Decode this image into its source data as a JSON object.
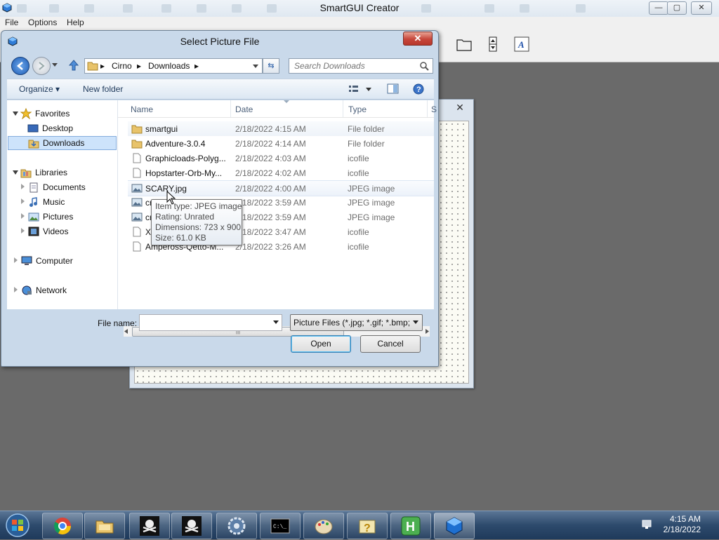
{
  "app": {
    "title": "SmartGUI Creator",
    "menu": [
      "File",
      "Options",
      "Help"
    ],
    "win_min": "—",
    "win_max": "▢",
    "win_close": "✕"
  },
  "form_window": {
    "close_label": "✕"
  },
  "dialog": {
    "title": "Select Picture File",
    "close_label": "✕",
    "breadcrumb": [
      "Cirno",
      "Downloads"
    ],
    "search_placeholder": "Search Downloads",
    "organize_label": "Organize ▾",
    "new_folder_label": "New folder",
    "nav": {
      "favorites": "Favorites",
      "desktop": "Desktop",
      "downloads": "Downloads",
      "libraries": "Libraries",
      "documents": "Documents",
      "music": "Music",
      "pictures": "Pictures",
      "videos": "Videos",
      "computer": "Computer",
      "network": "Network"
    },
    "columns": {
      "name": "Name",
      "date": "Date",
      "type": "Type",
      "size": "S"
    },
    "files": [
      {
        "name": "smartgui",
        "date": "2/18/2022 4:15 AM",
        "type": "File folder",
        "icon": "folder-icon"
      },
      {
        "name": "Adventure-3.0.4",
        "date": "2/18/2022 4:14 AM",
        "type": "File folder",
        "icon": "folder-icon"
      },
      {
        "name": "Graphicloads-Polyg...",
        "date": "2/18/2022 4:03 AM",
        "type": "icofile",
        "icon": "file-icon"
      },
      {
        "name": "Hopstarter-Orb-My...",
        "date": "2/18/2022 4:02 AM",
        "type": "icofile",
        "icon": "file-icon"
      },
      {
        "name": "SCARY.jpg",
        "date": "2/18/2022 4:00 AM",
        "type": "JPEG image",
        "icon": "image-icon"
      },
      {
        "name": "cr",
        "date": "2/18/2022 3:59 AM",
        "type": "JPEG image",
        "icon": "image-icon"
      },
      {
        "name": "cr",
        "date": "2/18/2022 3:59 AM",
        "type": "JPEG image",
        "icon": "image-icon"
      },
      {
        "name": "Xe",
        "date": "2/18/2022 3:47 AM",
        "type": "icofile",
        "icon": "file-icon"
      },
      {
        "name": "Ampeross-Qetto-M...",
        "date": "2/18/2022 3:26 AM",
        "type": "icofile",
        "icon": "file-icon"
      }
    ],
    "tooltip": {
      "item_type": "Item type: JPEG image",
      "rating": "Rating: Unrated",
      "dimensions": "Dimensions: 723 x 900",
      "size": "Size: 61.0 KB"
    },
    "file_name_label": "File name:",
    "file_name_value": "",
    "file_type": "Picture Files (*.jpg; *.gif; *.bmp;",
    "open_label": "Open",
    "cancel_label": "Cancel"
  },
  "taskbar": {
    "time": "4:15 AM",
    "date": "2/18/2022",
    "apps": [
      "chrome-icon",
      "explorer-icon",
      "pirate-icon",
      "pirate-icon",
      "settings-icon",
      "terminal-icon",
      "paint-icon",
      "help-icon",
      "h-app-icon",
      "cube-icon"
    ]
  }
}
